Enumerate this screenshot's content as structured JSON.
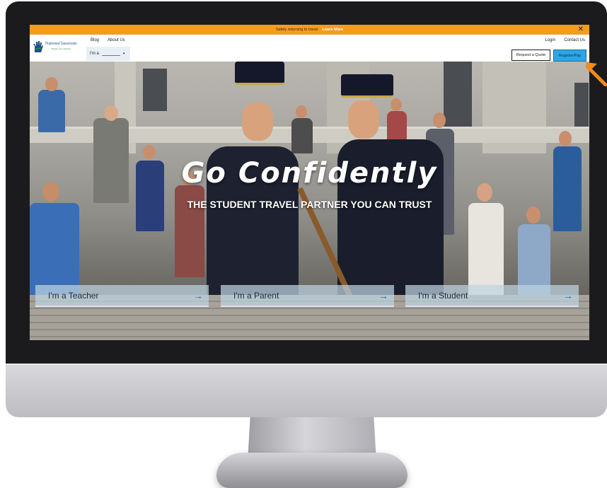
{
  "announcement": {
    "text": "Safely returning to travel",
    "link": "Learn More"
  },
  "nav": {
    "logo_text": "NationsClassroom",
    "logo_sub": "Hands-on Learning",
    "blog": "Blog",
    "about": "About Us",
    "login": "Login",
    "contact": "Contact Us",
    "role_label": "I'm a",
    "quote_button": "Request a Quote",
    "register_button": "Register/Pay"
  },
  "hero": {
    "title": "Go Confidently",
    "subtitle": "THE STUDENT TRAVEL PARTNER YOU CAN TRUST",
    "ctas": [
      {
        "label": "I'm a Teacher"
      },
      {
        "label": "I'm a Parent"
      },
      {
        "label": "I'm a Student"
      }
    ]
  },
  "icons": {
    "close": "close-icon",
    "arrow": "arrow-right-icon",
    "caret": "chevron-down-icon",
    "pointer": "pointer-arrow-icon"
  },
  "colors": {
    "announcement_bg": "#f39c1f",
    "register_bg": "#2aa7e5",
    "pointer": "#f28a1e"
  }
}
